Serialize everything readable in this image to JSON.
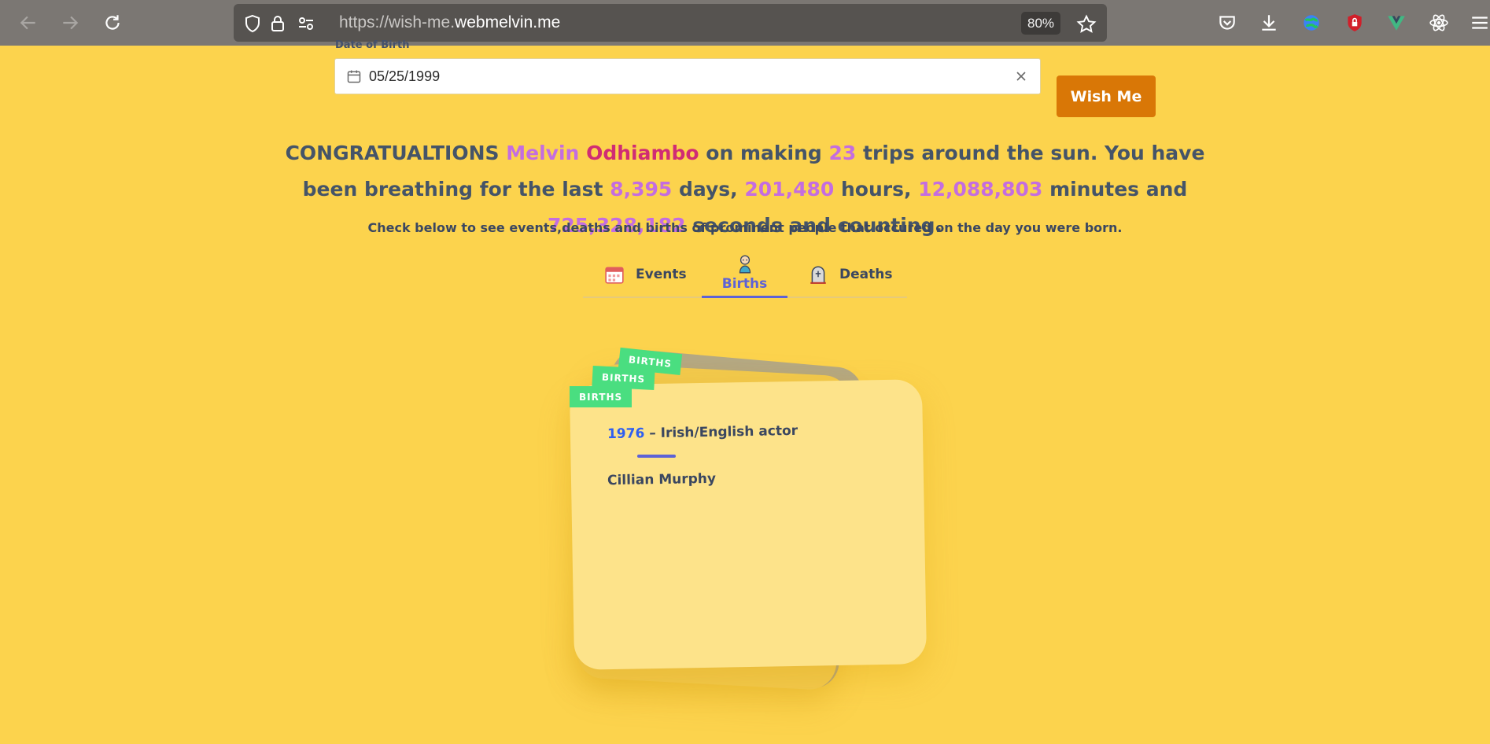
{
  "browser": {
    "url_prefix": "https://wish-me.",
    "url_domain": "webmelvin.me",
    "zoom": "80%"
  },
  "form": {
    "date_label": "Date of Birth",
    "date_value": "05/25/1999",
    "submit_label": "Wish Me"
  },
  "message": {
    "w_congrats": "CONGRATUALTIONS",
    "first_name": "Melvin",
    "last_name": "Odhiambo",
    "w_on_making": "on making",
    "trips": "23",
    "w_trips_text": "trips around the sun. You have been breathing for the last",
    "days": "8,395",
    "w_days": "days,",
    "hours": "201,480",
    "w_hours": "hours,",
    "minutes": "12,088,803",
    "w_minutes_and": "minutes and",
    "seconds": "725,328,182",
    "w_seconds": "seconds and counting."
  },
  "subtitle": "Check below to see events,deaths and births of prominent people that occured on the day you were born.",
  "tabs": [
    {
      "label": "Events",
      "icon": "calendar-icon"
    },
    {
      "label": "Births",
      "icon": "baby-icon",
      "active": true
    },
    {
      "label": "Deaths",
      "icon": "tombstone-icon"
    }
  ],
  "cards": {
    "tag_label": "BIRTHS",
    "year": "1976",
    "separator": "–",
    "description": "Irish/English actor",
    "person": "Cillian Murphy"
  },
  "colors": {
    "background": "#fcd34d",
    "accent": "#5d62d6",
    "button": "#d97706",
    "tag": "#4ade80"
  }
}
